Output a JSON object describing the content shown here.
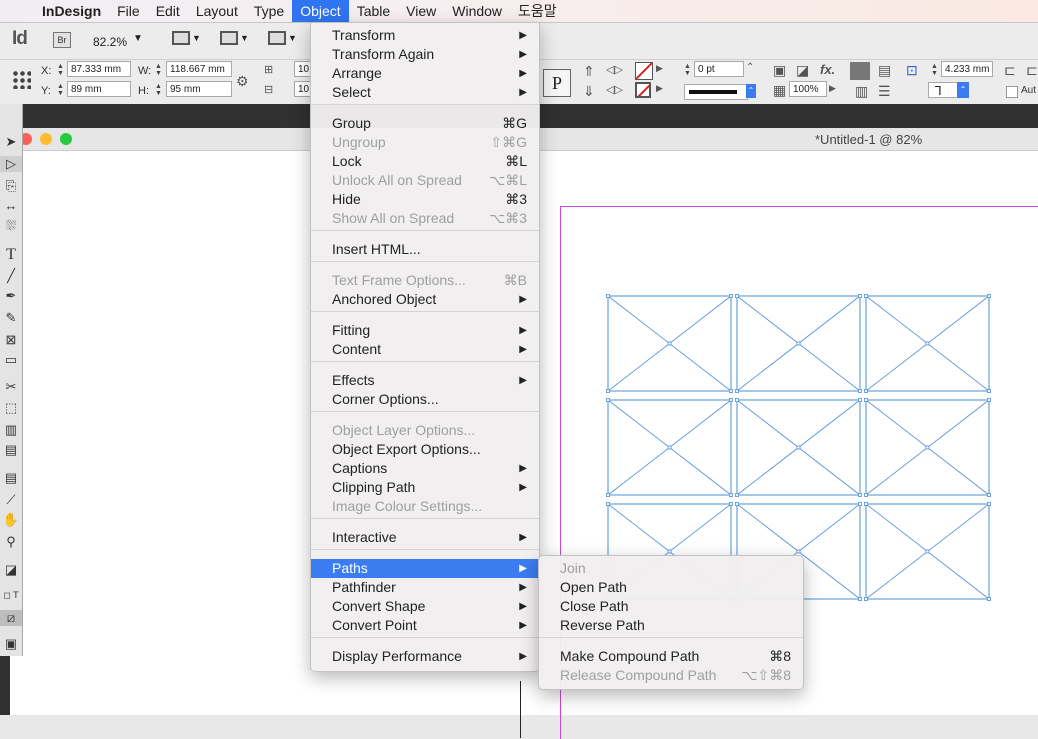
{
  "menubar": {
    "app": "InDesign",
    "items": [
      "File",
      "Edit",
      "Layout",
      "Type",
      "Object",
      "Table",
      "View",
      "Window",
      "도움말"
    ],
    "active": "Object"
  },
  "appbar": {
    "logo": "Id",
    "bridge": "Br",
    "zoom": "82.2%"
  },
  "control": {
    "x_label": "X:",
    "x_value": "87.333 mm",
    "y_label": "Y:",
    "y_value": "89 mm",
    "w_label": "W:",
    "w_value": "118.667 mm",
    "h_label": "H:",
    "h_value": "95 mm",
    "trunc_top": "10",
    "trunc_bottom": "10",
    "stroke_weight": "0 pt",
    "opacity": "100%",
    "offset": "4.233 mm",
    "auto": "Aut"
  },
  "document": {
    "title": "*Untitled-1 @ 82%"
  },
  "object_menu": {
    "items": [
      {
        "label": "Transform",
        "shortcut": "",
        "submenu": true,
        "disabled": false
      },
      {
        "label": "Transform Again",
        "shortcut": "",
        "submenu": true,
        "disabled": false
      },
      {
        "label": "Arrange",
        "shortcut": "",
        "submenu": true,
        "disabled": false
      },
      {
        "label": "Select",
        "shortcut": "",
        "submenu": true,
        "disabled": false
      },
      {
        "label": "Group",
        "shortcut": "⌘G",
        "submenu": false,
        "disabled": false
      },
      {
        "label": "Ungroup",
        "shortcut": "⇧⌘G",
        "submenu": false,
        "disabled": true
      },
      {
        "label": "Lock",
        "shortcut": "⌘L",
        "submenu": false,
        "disabled": false
      },
      {
        "label": "Unlock All on Spread",
        "shortcut": "⌥⌘L",
        "submenu": false,
        "disabled": true
      },
      {
        "label": "Hide",
        "shortcut": "⌘3",
        "submenu": false,
        "disabled": false
      },
      {
        "label": "Show All on Spread",
        "shortcut": "⌥⌘3",
        "submenu": false,
        "disabled": true
      },
      {
        "label": "Insert HTML...",
        "shortcut": "",
        "submenu": false,
        "disabled": false
      },
      {
        "label": "Text Frame Options...",
        "shortcut": "⌘B",
        "submenu": false,
        "disabled": true
      },
      {
        "label": "Anchored Object",
        "shortcut": "",
        "submenu": true,
        "disabled": false
      },
      {
        "label": "Fitting",
        "shortcut": "",
        "submenu": true,
        "disabled": false
      },
      {
        "label": "Content",
        "shortcut": "",
        "submenu": true,
        "disabled": false
      },
      {
        "label": "Effects",
        "shortcut": "",
        "submenu": true,
        "disabled": false
      },
      {
        "label": "Corner Options...",
        "shortcut": "",
        "submenu": false,
        "disabled": false
      },
      {
        "label": "Object Layer Options...",
        "shortcut": "",
        "submenu": false,
        "disabled": true
      },
      {
        "label": "Object Export Options...",
        "shortcut": "",
        "submenu": false,
        "disabled": false
      },
      {
        "label": "Captions",
        "shortcut": "",
        "submenu": true,
        "disabled": false
      },
      {
        "label": "Clipping Path",
        "shortcut": "",
        "submenu": true,
        "disabled": false
      },
      {
        "label": "Image Colour Settings...",
        "shortcut": "",
        "submenu": false,
        "disabled": true
      },
      {
        "label": "Interactive",
        "shortcut": "",
        "submenu": true,
        "disabled": false
      },
      {
        "label": "Paths",
        "shortcut": "",
        "submenu": true,
        "disabled": false,
        "highlighted": true
      },
      {
        "label": "Pathfinder",
        "shortcut": "",
        "submenu": true,
        "disabled": false
      },
      {
        "label": "Convert Shape",
        "shortcut": "",
        "submenu": true,
        "disabled": false
      },
      {
        "label": "Convert Point",
        "shortcut": "",
        "submenu": true,
        "disabled": false
      },
      {
        "label": "Display Performance",
        "shortcut": "",
        "submenu": true,
        "disabled": false
      }
    ]
  },
  "paths_submenu": {
    "items": [
      {
        "label": "Join",
        "shortcut": "",
        "disabled": true
      },
      {
        "label": "Open Path",
        "shortcut": "",
        "disabled": false
      },
      {
        "label": "Close Path",
        "shortcut": "",
        "disabled": false
      },
      {
        "label": "Reverse Path",
        "shortcut": "",
        "disabled": false
      },
      {
        "label": "Make Compound Path",
        "shortcut": "⌘8",
        "disabled": false
      },
      {
        "label": "Release Compound Path",
        "shortcut": "⌥⇧⌘8",
        "disabled": true
      }
    ]
  },
  "colors": {
    "highlight": "#3b7cf1",
    "frame_stroke": "#4a90d9",
    "margin_guide": "#c64bd8"
  },
  "icons": [
    "apple-icon",
    "selection-tool-icon",
    "direct-selection-tool-icon",
    "type-tool-icon",
    "pen-tool-icon",
    "scissors-tool-icon",
    "hand-tool-icon",
    "zoom-tool-icon",
    "fx-icon"
  ]
}
